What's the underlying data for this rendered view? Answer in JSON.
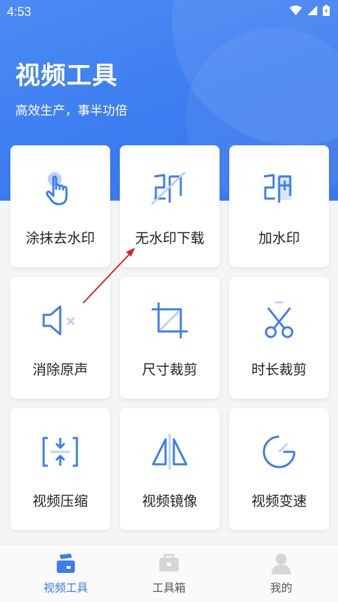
{
  "status": {
    "time": "4:53"
  },
  "header": {
    "title": "视频工具",
    "subtitle": "高效生产，事半功倍"
  },
  "tools": [
    {
      "label": "涂抹去水印",
      "icon": "hand-tap-icon"
    },
    {
      "label": "无水印下载",
      "icon": "no-watermark-icon"
    },
    {
      "label": "加水印",
      "icon": "add-watermark-icon"
    },
    {
      "label": "消除原声",
      "icon": "mute-icon"
    },
    {
      "label": "尺寸裁剪",
      "icon": "crop-icon"
    },
    {
      "label": "时长裁剪",
      "icon": "scissors-icon"
    },
    {
      "label": "视频压缩",
      "icon": "compress-icon"
    },
    {
      "label": "视频镜像",
      "icon": "mirror-icon"
    },
    {
      "label": "视频变速",
      "icon": "speed-icon"
    }
  ],
  "nav": [
    {
      "label": "视频工具",
      "icon": "video-tools-icon",
      "active": true
    },
    {
      "label": "工具箱",
      "icon": "toolbox-icon",
      "active": false
    },
    {
      "label": "我的",
      "icon": "profile-icon",
      "active": false
    }
  ],
  "colors": {
    "accent": "#3b7cf0",
    "annotation_arrow": "#e02020"
  }
}
